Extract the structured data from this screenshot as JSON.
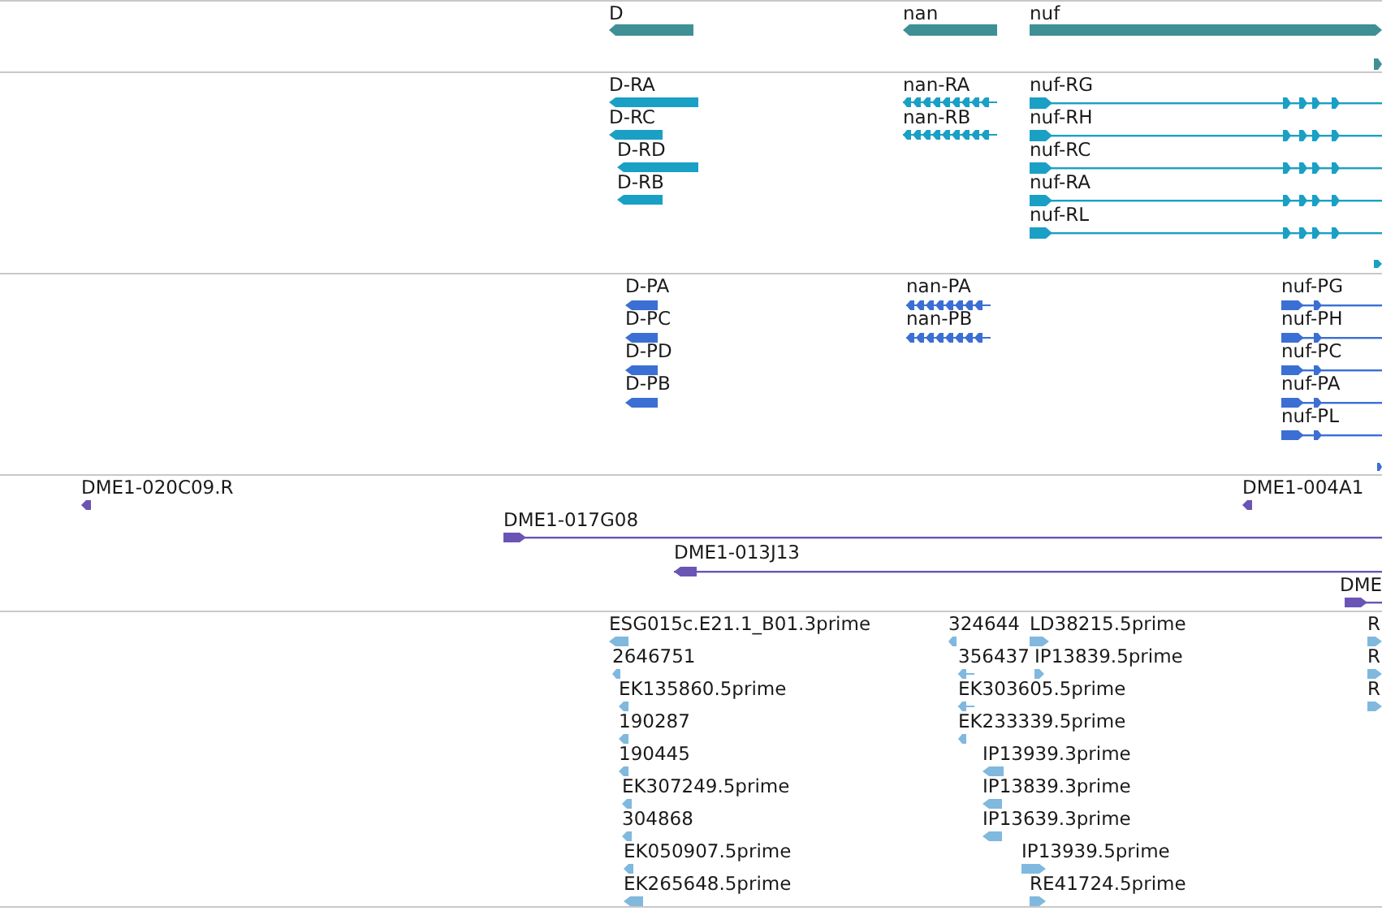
{
  "tracks": [
    {
      "kind": "gene",
      "color": "#3f9095",
      "features": [
        {
          "label": "D",
          "reverse": true
        },
        {
          "label": "nan",
          "reverse": true
        },
        {
          "label": "nuf",
          "reverse": false
        },
        {
          "reverse": false
        }
      ]
    },
    {
      "kind": "transcript",
      "color": "#1aa0c4",
      "features": [
        {
          "label": "D-RA",
          "reverse": true
        },
        {
          "label": "D-RC",
          "reverse": true
        },
        {
          "label": "D-RD",
          "reverse": true
        },
        {
          "label": "D-RB",
          "reverse": true
        },
        {
          "label": "nan-RA",
          "reverse": true
        },
        {
          "label": "nan-RB",
          "reverse": true
        },
        {
          "label": "nuf-RG",
          "reverse": false
        },
        {
          "label": "nuf-RH",
          "reverse": false
        },
        {
          "label": "nuf-RC",
          "reverse": false
        },
        {
          "label": "nuf-RA",
          "reverse": false
        },
        {
          "label": "nuf-RL",
          "reverse": false
        },
        {
          "reverse": false
        }
      ]
    },
    {
      "kind": "protein",
      "color": "#3b6fd4",
      "features": [
        {
          "label": "D-PA",
          "reverse": true
        },
        {
          "label": "D-PC",
          "reverse": true
        },
        {
          "label": "D-PD",
          "reverse": true
        },
        {
          "label": "D-PB",
          "reverse": true
        },
        {
          "label": "nan-PA",
          "reverse": true
        },
        {
          "label": "nan-PB",
          "reverse": true
        },
        {
          "label": "nuf-PG",
          "reverse": false
        },
        {
          "label": "nuf-PH",
          "reverse": false
        },
        {
          "label": "nuf-PC",
          "reverse": false
        },
        {
          "label": "nuf-PA",
          "reverse": false
        },
        {
          "label": "nuf-PL",
          "reverse": false
        },
        {
          "reverse": false
        }
      ]
    },
    {
      "kind": "clone",
      "color": "#6a55b4",
      "features": [
        {
          "label": "DME1-020C09.R",
          "reverse": true
        },
        {
          "label": "DME1-004A1",
          "reverse": true
        },
        {
          "label": "DME1-017G08",
          "reverse": false
        },
        {
          "label": "DME1-013J13",
          "reverse": true
        },
        {
          "label": "DME",
          "reverse": false
        }
      ]
    },
    {
      "kind": "est",
      "color": "#80b8de",
      "features": [
        {
          "label": "ESG015c.E21.1_B01.3prime",
          "reverse": true
        },
        {
          "label": "2646751",
          "reverse": true
        },
        {
          "label": "EK135860.5prime",
          "reverse": true
        },
        {
          "label": "190287",
          "reverse": true
        },
        {
          "label": "190445",
          "reverse": true
        },
        {
          "label": "EK307249.5prime",
          "reverse": true
        },
        {
          "label": "304868",
          "reverse": true
        },
        {
          "label": "EK050907.5prime",
          "reverse": true
        },
        {
          "label": "EK265648.5prime",
          "reverse": true
        },
        {
          "label": "324644",
          "reverse": true
        },
        {
          "label": "LD38215.5prime",
          "reverse": false
        },
        {
          "label": "356437",
          "reverse": true
        },
        {
          "label": "IP13839.5prime",
          "reverse": false
        },
        {
          "label": "EK303605.5prime",
          "reverse": true
        },
        {
          "label": "EK233339.5prime",
          "reverse": true
        },
        {
          "label": "IP13939.3prime",
          "reverse": true
        },
        {
          "label": "IP13839.3prime",
          "reverse": true
        },
        {
          "label": "IP13639.3prime",
          "reverse": true
        },
        {
          "label": "IP13939.5prime",
          "reverse": false
        },
        {
          "label": "RE41724.5prime",
          "reverse": false
        },
        {
          "label": "R",
          "reverse": false
        },
        {
          "label": "R",
          "reverse": false
        },
        {
          "label": "R",
          "reverse": false
        }
      ]
    }
  ]
}
